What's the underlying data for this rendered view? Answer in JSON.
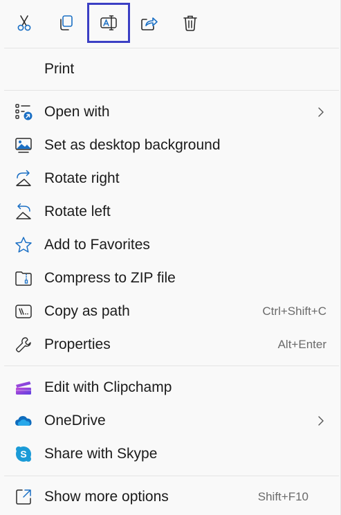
{
  "toolbar": {
    "buttons": [
      {
        "icon": "scissors-icon",
        "name": "cut-button"
      },
      {
        "icon": "copy-icon",
        "name": "copy-button"
      },
      {
        "icon": "rename-icon",
        "name": "rename-button",
        "selected": true
      },
      {
        "icon": "share-icon",
        "name": "share-button"
      },
      {
        "icon": "trash-icon",
        "name": "delete-button"
      }
    ]
  },
  "items": {
    "print": {
      "label": "Print"
    },
    "open_with": {
      "label": "Open with",
      "has_submenu": true
    },
    "set_background": {
      "label": "Set as desktop background"
    },
    "rotate_right": {
      "label": "Rotate right"
    },
    "rotate_left": {
      "label": "Rotate left"
    },
    "favorites": {
      "label": "Add to Favorites"
    },
    "compress": {
      "label": "Compress to ZIP file"
    },
    "copy_path": {
      "label": "Copy as path",
      "shortcut": "Ctrl+Shift+C"
    },
    "properties": {
      "label": "Properties",
      "shortcut": "Alt+Enter"
    },
    "clipchamp": {
      "label": "Edit with Clipchamp"
    },
    "onedrive": {
      "label": "OneDrive",
      "has_submenu": true
    },
    "skype": {
      "label": "Share with Skype"
    },
    "more_options": {
      "label": "Show more options",
      "shortcut": "Shift+F10"
    }
  },
  "colors": {
    "accent_blue": "#1a6fc4",
    "selection_border": "#3b3fc4",
    "onedrive_blue": "#0f6cbd",
    "skype_blue": "#1b9bd7",
    "clipchamp_purple": "#7b3fe4"
  }
}
